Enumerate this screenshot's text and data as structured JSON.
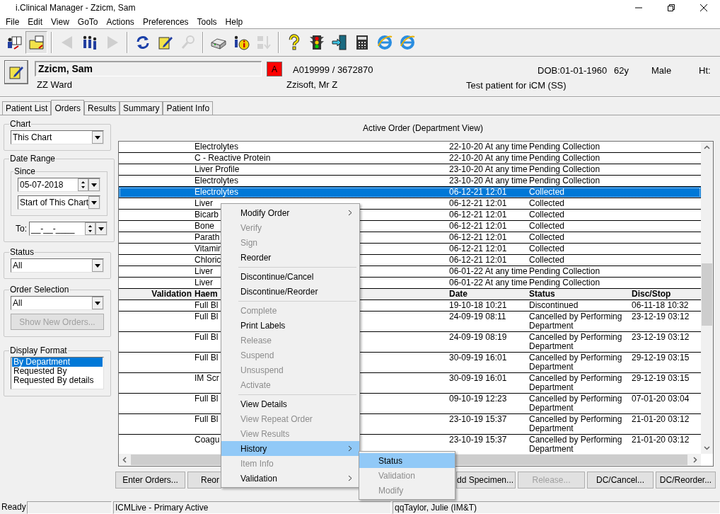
{
  "window": {
    "title": "i.Clinical Manager - Zzicm, Sam"
  },
  "menu_bar": [
    "File",
    "Edit",
    "View",
    "GoTo",
    "Actions",
    "Preferences",
    "Tools",
    "Help"
  ],
  "toolbar": [
    {
      "kind": "patients",
      "disabled": false,
      "pressed": false
    },
    {
      "kind": "folder",
      "disabled": false,
      "pressed": true
    },
    {
      "kind": "separator"
    },
    {
      "kind": "back",
      "disabled": true,
      "pressed": false
    },
    {
      "kind": "people",
      "disabled": false,
      "pressed": false
    },
    {
      "kind": "forward",
      "disabled": true,
      "pressed": false
    },
    {
      "kind": "separator"
    },
    {
      "kind": "refresh",
      "disabled": false,
      "pressed": false
    },
    {
      "kind": "edit",
      "disabled": false,
      "pressed": false
    },
    {
      "kind": "search",
      "disabled": true,
      "pressed": false
    },
    {
      "kind": "separator"
    },
    {
      "kind": "print",
      "disabled": false,
      "pressed": false
    },
    {
      "kind": "info",
      "disabled": false,
      "pressed": false
    },
    {
      "kind": "sort",
      "disabled": true,
      "pressed": false
    },
    {
      "kind": "separator"
    },
    {
      "kind": "help",
      "disabled": false,
      "pressed": false
    },
    {
      "kind": "traffic",
      "disabled": false,
      "pressed": false
    },
    {
      "kind": "exit",
      "disabled": false,
      "pressed": false
    },
    {
      "kind": "calculator",
      "disabled": false,
      "pressed": false
    },
    {
      "kind": "browser",
      "disabled": false,
      "pressed": false
    },
    {
      "kind": "browser",
      "disabled": false,
      "pressed": false
    }
  ],
  "patient": {
    "name": "Zzicm, Sam",
    "ward": "ZZ Ward",
    "alert": "A",
    "id": "A019999 / 3672870",
    "consultant": "Zzisoft, Mr Z",
    "dob": "DOB:01-01-1960",
    "age": "62y",
    "sex": "Male",
    "height": "Ht:",
    "note": "Test patient for iCM (SS)"
  },
  "tabs": [
    {
      "label": "Patient List",
      "selected": false
    },
    {
      "label": "Orders",
      "selected": true
    },
    {
      "label": "Results",
      "selected": false
    },
    {
      "label": "Summary",
      "selected": false
    },
    {
      "label": "Patient Info",
      "selected": false
    }
  ],
  "filters": {
    "chart": {
      "label": "Chart",
      "value": "This Chart"
    },
    "date_range": {
      "label": "Date Range",
      "since_label": "Since",
      "since_date": "05-07-2018",
      "since_preset": "Start of This Chart",
      "to_label": "To:",
      "to_value": "__-__-____"
    },
    "status": {
      "label": "Status",
      "value": "All"
    },
    "order_selection": {
      "label": "Order Selection",
      "value": "All",
      "button": {
        "label": "Show New Orders...",
        "disabled": true
      }
    },
    "display_format": {
      "label": "Display Format",
      "options": [
        {
          "label": "By Department",
          "selected": true
        },
        {
          "label": "Requested By",
          "selected": false
        },
        {
          "label": "Requested By details",
          "selected": false
        }
      ]
    }
  },
  "orders": {
    "title": "Active Order (Department View)",
    "rows": [
      {
        "name": "Electrolytes",
        "date": "22-10-20 At any time",
        "status": "Pending Collection",
        "selected": false
      },
      {
        "name": "C - Reactive Protein",
        "date": "22-10-20 At any time",
        "status": "Pending Collection",
        "selected": false
      },
      {
        "name": "Liver Profile",
        "date": "23-10-20 At any time",
        "status": "Pending Collection",
        "selected": false
      },
      {
        "name": "Electrolytes",
        "date": "23-10-20 At any time",
        "status": "Pending Collection",
        "selected": false
      },
      {
        "name": "Electrolytes",
        "date": "06-12-21 12:01",
        "status": "Collected",
        "selected": true
      },
      {
        "name": "Liver",
        "date": "06-12-21 12:01",
        "status": "Collected",
        "selected": false
      },
      {
        "name": "Bicarb",
        "date": "06-12-21 12:01",
        "status": "Collected",
        "selected": false
      },
      {
        "name": "Bone",
        "date": "06-12-21 12:01",
        "status": "Collected",
        "selected": false
      },
      {
        "name": "Parath",
        "date": "06-12-21 12:01",
        "status": "Collected",
        "selected": false
      },
      {
        "name": "Vitamin",
        "date": "06-12-21 12:01",
        "status": "Collected",
        "selected": false
      },
      {
        "name": "Chloric",
        "date": "06-12-21 12:01",
        "status": "Collected",
        "selected": false
      },
      {
        "name": "Liver",
        "date": "06-01-22 At any time",
        "status": "Pending Collection",
        "selected": false
      },
      {
        "name": "Liver",
        "date": "06-01-22 At any time",
        "status": "Pending Collection",
        "selected": false
      }
    ],
    "group_header": {
      "validation": "Validation",
      "department": "Haem",
      "date": "Date",
      "status": "Status",
      "disc_stop": "Disc/Stop"
    },
    "group_rows": [
      {
        "name": "Full Bl",
        "date": "19-10-18 10:21",
        "status": "Discontinued",
        "disc_stop": "06-11-18 10:32"
      },
      {
        "name": "Full Bl",
        "date": "24-09-19 08:11",
        "status": "Cancelled by Performing Department",
        "disc_stop": "23-12-19 03:12"
      },
      {
        "name": "Full Bl",
        "date": "24-09-19 08:19",
        "status": "Cancelled by Performing Department",
        "disc_stop": "23-12-19 03:12"
      },
      {
        "name": "Full Bl",
        "date": "30-09-19 16:01",
        "status": "Cancelled by Performing Department",
        "disc_stop": "29-12-19 03:15"
      },
      {
        "name": "IM Scr",
        "date": "30-09-19 16:01",
        "status": "Cancelled by Performing Department",
        "disc_stop": "29-12-19 03:15"
      },
      {
        "name": "Full Bl",
        "date": "09-10-19 12:23",
        "status": "Cancelled by Performing Department",
        "disc_stop": "07-01-20 03:04"
      },
      {
        "name": "Full Bl",
        "date": "23-10-19 15:37",
        "status": "Cancelled by Performing Department",
        "disc_stop": "21-01-20 03:12"
      },
      {
        "name": "Coagu",
        "date": "23-10-19 15:37",
        "status": "Cancelled by Performing Department",
        "disc_stop": "21-01-20 03:12"
      }
    ]
  },
  "context_menu": [
    {
      "kind": "item",
      "label": "Modify Order",
      "disabled": false,
      "submenu": true,
      "selected": false
    },
    {
      "kind": "item",
      "label": "Verify",
      "disabled": true,
      "submenu": false,
      "selected": false
    },
    {
      "kind": "item",
      "label": "Sign",
      "disabled": true,
      "submenu": false,
      "selected": false
    },
    {
      "kind": "item",
      "label": "Reorder",
      "disabled": false,
      "submenu": false,
      "selected": false
    },
    {
      "kind": "separator"
    },
    {
      "kind": "item",
      "label": "Discontinue/Cancel",
      "disabled": false,
      "submenu": false,
      "selected": false
    },
    {
      "kind": "item",
      "label": "Discontinue/Reorder",
      "disabled": false,
      "submenu": false,
      "selected": false
    },
    {
      "kind": "separator"
    },
    {
      "kind": "item",
      "label": "Complete",
      "disabled": true,
      "submenu": false,
      "selected": false
    },
    {
      "kind": "item",
      "label": "Print Labels",
      "disabled": false,
      "submenu": false,
      "selected": false
    },
    {
      "kind": "item",
      "label": "Release",
      "disabled": true,
      "submenu": false,
      "selected": false
    },
    {
      "kind": "item",
      "label": "Suspend",
      "disabled": true,
      "submenu": false,
      "selected": false
    },
    {
      "kind": "item",
      "label": "Unsuspend",
      "disabled": true,
      "submenu": false,
      "selected": false
    },
    {
      "kind": "item",
      "label": "Activate",
      "disabled": true,
      "submenu": false,
      "selected": false
    },
    {
      "kind": "separator"
    },
    {
      "kind": "item",
      "label": "View Details",
      "disabled": false,
      "submenu": false,
      "selected": false
    },
    {
      "kind": "item",
      "label": "View Repeat Order",
      "disabled": true,
      "submenu": false,
      "selected": false
    },
    {
      "kind": "item",
      "label": "View Results",
      "disabled": true,
      "submenu": false,
      "selected": false
    },
    {
      "kind": "item",
      "label": "History",
      "disabled": false,
      "submenu": true,
      "selected": true
    },
    {
      "kind": "item",
      "label": "Item Info",
      "disabled": true,
      "submenu": false,
      "selected": false
    },
    {
      "kind": "item",
      "label": "Validation",
      "disabled": false,
      "submenu": true,
      "selected": false
    }
  ],
  "submenu": [
    {
      "label": "Status",
      "disabled": false,
      "selected": true
    },
    {
      "label": "Validation",
      "disabled": true,
      "selected": false
    },
    {
      "label": "Modify",
      "disabled": true,
      "selected": false
    }
  ],
  "buttons_left": [
    {
      "label": "Enter Orders...",
      "disabled": false
    },
    {
      "label": "Reor",
      "disabled": false
    }
  ],
  "buttons_right": [
    {
      "label": "dd Specimen...",
      "disabled": false
    },
    {
      "label": "Release...",
      "disabled": true
    },
    {
      "label": "DC/Cancel...",
      "disabled": false
    },
    {
      "label": "DC/Reorder...",
      "disabled": false
    }
  ],
  "status_bar": [
    "Ready",
    "ICMLive - Primary Active",
    "qqTaylor, Julie (IM&T)"
  ]
}
